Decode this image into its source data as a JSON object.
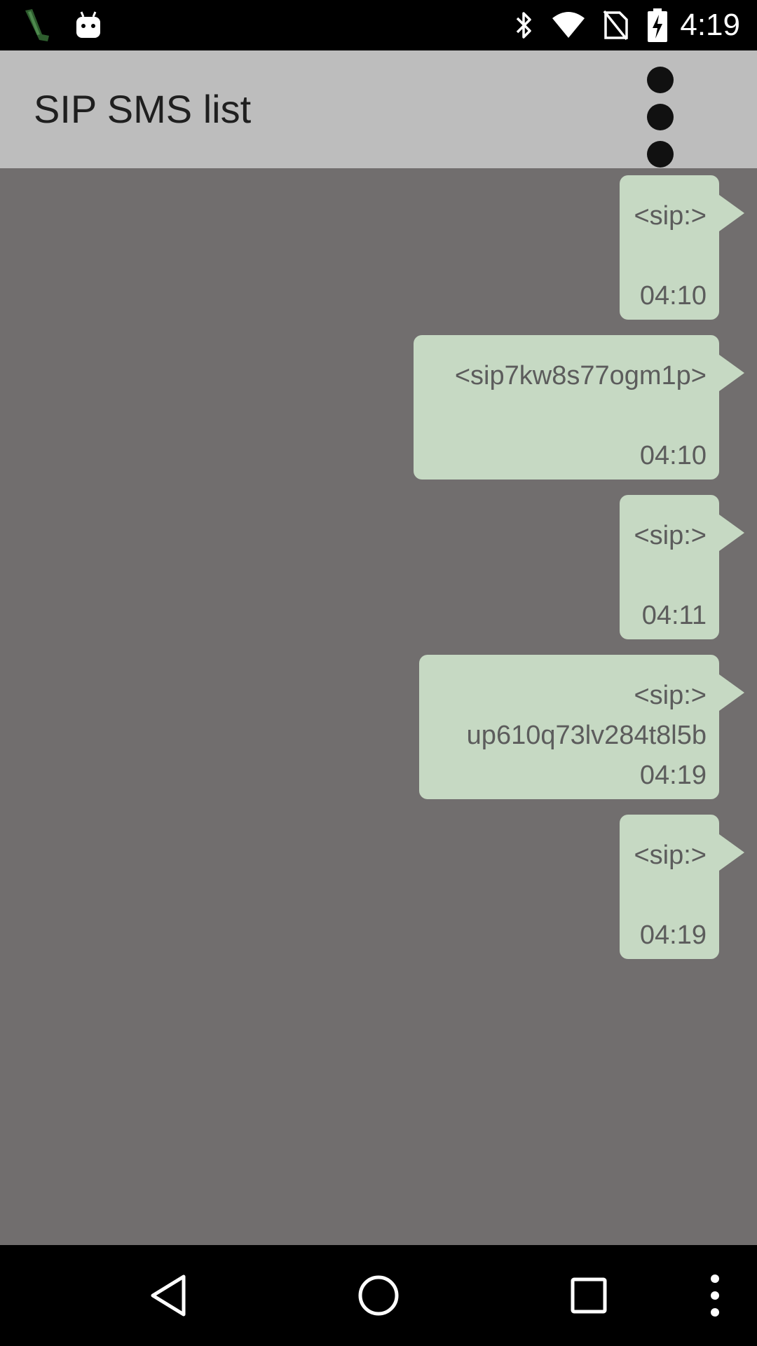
{
  "status_bar": {
    "time": "4:19",
    "left_icons": [
      "phone-signal-app-icon",
      "android-robot-icon"
    ],
    "right_icons": [
      "bluetooth-icon",
      "wifi-icon",
      "no-sim-icon",
      "battery-charging-icon"
    ]
  },
  "app_bar": {
    "title": "SIP SMS list",
    "menu_icon": "overflow-menu-icon"
  },
  "messages": [
    {
      "sender": "<sip:>",
      "body": "",
      "time": "04:10"
    },
    {
      "sender": "<sip7kw8s77ogm1p>",
      "body": "",
      "time": "04:10"
    },
    {
      "sender": "<sip:>",
      "body": "",
      "time": "04:11"
    },
    {
      "sender": "<sip:>",
      "body": "up610q73lv284t8l5b",
      "time": "04:19"
    },
    {
      "sender": "<sip:>",
      "body": "",
      "time": "04:19"
    }
  ],
  "nav_bar": {
    "buttons": [
      "back-icon",
      "home-icon",
      "recents-icon",
      "more-icon"
    ]
  },
  "colors": {
    "background": "#716e6e",
    "app_bar": "#bdbdbd",
    "bubble": "#c6d9c3",
    "bubble_text": "#5c5c5c",
    "system_bars": "#000000"
  }
}
